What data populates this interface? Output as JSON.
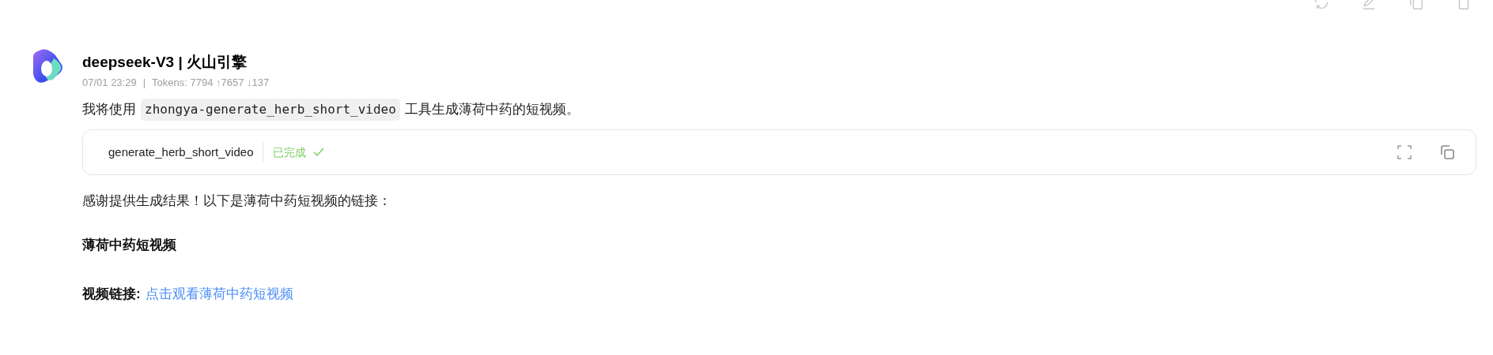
{
  "message": {
    "model": "deepseek-V3 | 火山引擎",
    "time": "07/01 23:29",
    "separator": "|",
    "tokens": "Tokens: 7794 ↑7657 ↓137",
    "intro": [
      {
        "kind": "text",
        "text": "我将使用"
      },
      {
        "kind": "code",
        "text": "zhongya-generate_herb_short_video"
      },
      {
        "kind": "text",
        "text": "工具生成薄荷中药的短视频。"
      }
    ],
    "tool_call": {
      "name": "generate_herb_short_video",
      "status": "已完成",
      "done": true
    },
    "reply": "感谢提供生成结果！以下是薄荷中药短视频的链接：",
    "heading": "薄荷中药短视频",
    "link_label": "视频链接:",
    "link_text": "点击观看薄荷中药短视频"
  }
}
